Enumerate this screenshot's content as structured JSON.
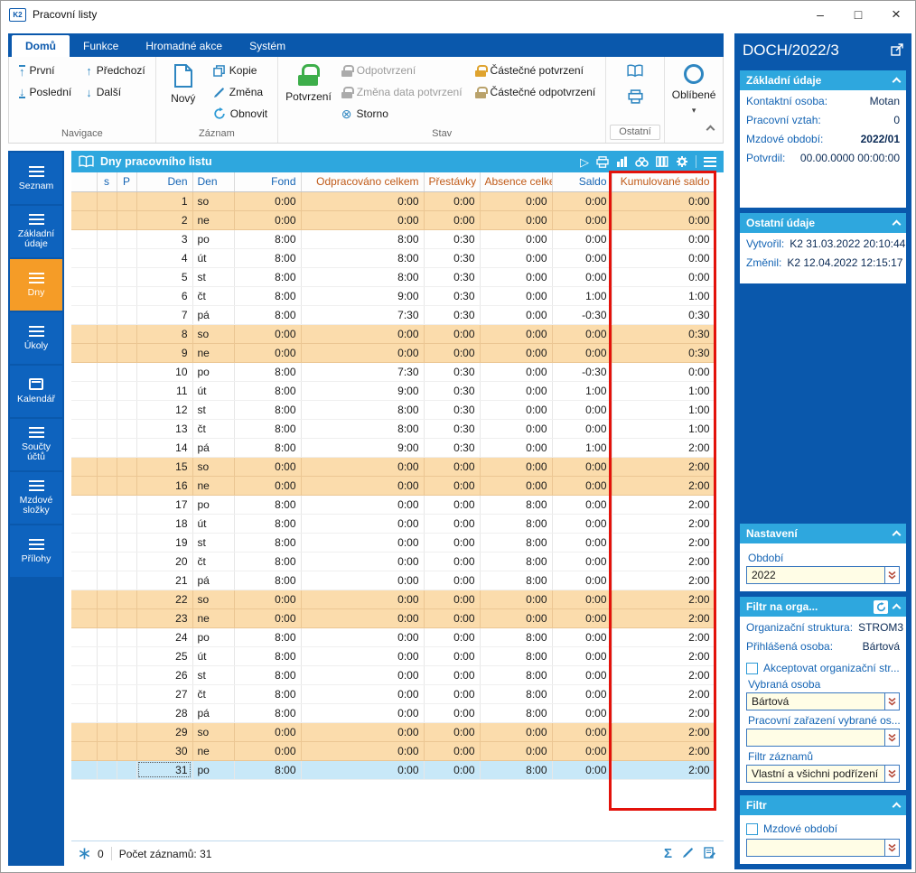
{
  "window": {
    "title": "Pracovní listy",
    "logo": "K2"
  },
  "tabs": [
    {
      "key": "domu",
      "label": "Domů",
      "active": true
    },
    {
      "key": "funkce",
      "label": "Funkce"
    },
    {
      "key": "hromadne-akce",
      "label": "Hromadné akce"
    },
    {
      "key": "system",
      "label": "Systém"
    }
  ],
  "ribbon": {
    "navigace": {
      "label": "Navigace",
      "prvni": "První",
      "posledni": "Poslední",
      "predchozi": "Předchozí",
      "dalsi": "Další"
    },
    "zaznam": {
      "label": "Záznam",
      "novy": "Nový",
      "kopie": "Kopie",
      "zmena": "Změna",
      "obnovit": "Obnovit"
    },
    "stav": {
      "label": "Stav",
      "potvrzeni": "Potvrzení",
      "odpotvrzeni": "Odpotvrzení",
      "zmena_data": "Změna data potvrzení",
      "storno": "Storno",
      "castecne_potvrzeni": "Částečné potvrzení",
      "castecne_odpotvrzeni": "Částečné odpotvrzení"
    },
    "ostatni": {
      "label": "Ostatní"
    },
    "oblibene": {
      "label": "Oblíbené"
    }
  },
  "sidebar": {
    "items": [
      {
        "key": "seznam",
        "label": "Seznam",
        "icon": "list"
      },
      {
        "key": "zakladni-udaje",
        "label": "Základní údaje",
        "icon": "list"
      },
      {
        "key": "dny",
        "label": "Dny",
        "icon": "list",
        "active": true
      },
      {
        "key": "ukoly",
        "label": "Úkoly",
        "icon": "list"
      },
      {
        "key": "kalendar",
        "label": "Kalendář",
        "icon": "calendar"
      },
      {
        "key": "soucty-uctu",
        "label": "Součty účtů",
        "icon": "list"
      },
      {
        "key": "mzdove-slozky",
        "label": "Mzdové složky",
        "icon": "list"
      },
      {
        "key": "prilohy",
        "label": "Přílohy",
        "icon": "list"
      }
    ]
  },
  "grid": {
    "title": "Dny pracovního listu",
    "columns": [
      {
        "key": "expander",
        "label": "",
        "color": "blue"
      },
      {
        "key": "s",
        "label": "s",
        "color": "blue"
      },
      {
        "key": "p",
        "label": "P",
        "color": "blue"
      },
      {
        "key": "den",
        "label": "Den",
        "color": "blue"
      },
      {
        "key": "nazev",
        "label": "Den",
        "color": "blue"
      },
      {
        "key": "fond",
        "label": "Fond",
        "color": "blue"
      },
      {
        "key": "odpracovano",
        "label": "Odpracováno celkem",
        "color": "orange"
      },
      {
        "key": "prestavky",
        "label": "Přestávky",
        "color": "orange"
      },
      {
        "key": "absence",
        "label": "Absence celkem",
        "color": "orange"
      },
      {
        "key": "saldo",
        "label": "Saldo",
        "color": "blue"
      },
      {
        "key": "kumulovane",
        "label": "Kumulované saldo",
        "color": "orange"
      }
    ],
    "rows": [
      {
        "den": 1,
        "nazev": "so",
        "fond": "0:00",
        "odpracovano": "0:00",
        "prestavky": "0:00",
        "absence": "0:00",
        "saldo": "0:00",
        "kumulovane": "0:00",
        "weekend": true
      },
      {
        "den": 2,
        "nazev": "ne",
        "fond": "0:00",
        "odpracovano": "0:00",
        "prestavky": "0:00",
        "absence": "0:00",
        "saldo": "0:00",
        "kumulovane": "0:00",
        "weekend": true
      },
      {
        "den": 3,
        "nazev": "po",
        "fond": "8:00",
        "odpracovano": "8:00",
        "prestavky": "0:30",
        "absence": "0:00",
        "saldo": "0:00",
        "kumulovane": "0:00"
      },
      {
        "den": 4,
        "nazev": "út",
        "fond": "8:00",
        "odpracovano": "8:00",
        "prestavky": "0:30",
        "absence": "0:00",
        "saldo": "0:00",
        "kumulovane": "0:00"
      },
      {
        "den": 5,
        "nazev": "st",
        "fond": "8:00",
        "odpracovano": "8:00",
        "prestavky": "0:30",
        "absence": "0:00",
        "saldo": "0:00",
        "kumulovane": "0:00"
      },
      {
        "den": 6,
        "nazev": "čt",
        "fond": "8:00",
        "odpracovano": "9:00",
        "prestavky": "0:30",
        "absence": "0:00",
        "saldo": "1:00",
        "kumulovane": "1:00"
      },
      {
        "den": 7,
        "nazev": "pá",
        "fond": "8:00",
        "odpracovano": "7:30",
        "prestavky": "0:30",
        "absence": "0:00",
        "saldo": "-0:30",
        "kumulovane": "0:30"
      },
      {
        "den": 8,
        "nazev": "so",
        "fond": "0:00",
        "odpracovano": "0:00",
        "prestavky": "0:00",
        "absence": "0:00",
        "saldo": "0:00",
        "kumulovane": "0:30",
        "weekend": true
      },
      {
        "den": 9,
        "nazev": "ne",
        "fond": "0:00",
        "odpracovano": "0:00",
        "prestavky": "0:00",
        "absence": "0:00",
        "saldo": "0:00",
        "kumulovane": "0:30",
        "weekend": true
      },
      {
        "den": 10,
        "nazev": "po",
        "fond": "8:00",
        "odpracovano": "7:30",
        "prestavky": "0:30",
        "absence": "0:00",
        "saldo": "-0:30",
        "kumulovane": "0:00"
      },
      {
        "den": 11,
        "nazev": "út",
        "fond": "8:00",
        "odpracovano": "9:00",
        "prestavky": "0:30",
        "absence": "0:00",
        "saldo": "1:00",
        "kumulovane": "1:00"
      },
      {
        "den": 12,
        "nazev": "st",
        "fond": "8:00",
        "odpracovano": "8:00",
        "prestavky": "0:30",
        "absence": "0:00",
        "saldo": "0:00",
        "kumulovane": "1:00"
      },
      {
        "den": 13,
        "nazev": "čt",
        "fond": "8:00",
        "odpracovano": "8:00",
        "prestavky": "0:30",
        "absence": "0:00",
        "saldo": "0:00",
        "kumulovane": "1:00"
      },
      {
        "den": 14,
        "nazev": "pá",
        "fond": "8:00",
        "odpracovano": "9:00",
        "prestavky": "0:30",
        "absence": "0:00",
        "saldo": "1:00",
        "kumulovane": "2:00"
      },
      {
        "den": 15,
        "nazev": "so",
        "fond": "0:00",
        "odpracovano": "0:00",
        "prestavky": "0:00",
        "absence": "0:00",
        "saldo": "0:00",
        "kumulovane": "2:00",
        "weekend": true
      },
      {
        "den": 16,
        "nazev": "ne",
        "fond": "0:00",
        "odpracovano": "0:00",
        "prestavky": "0:00",
        "absence": "0:00",
        "saldo": "0:00",
        "kumulovane": "2:00",
        "weekend": true
      },
      {
        "den": 17,
        "nazev": "po",
        "fond": "8:00",
        "odpracovano": "0:00",
        "prestavky": "0:00",
        "absence": "8:00",
        "saldo": "0:00",
        "kumulovane": "2:00"
      },
      {
        "den": 18,
        "nazev": "út",
        "fond": "8:00",
        "odpracovano": "0:00",
        "prestavky": "0:00",
        "absence": "8:00",
        "saldo": "0:00",
        "kumulovane": "2:00"
      },
      {
        "den": 19,
        "nazev": "st",
        "fond": "8:00",
        "odpracovano": "0:00",
        "prestavky": "0:00",
        "absence": "8:00",
        "saldo": "0:00",
        "kumulovane": "2:00"
      },
      {
        "den": 20,
        "nazev": "čt",
        "fond": "8:00",
        "odpracovano": "0:00",
        "prestavky": "0:00",
        "absence": "8:00",
        "saldo": "0:00",
        "kumulovane": "2:00"
      },
      {
        "den": 21,
        "nazev": "pá",
        "fond": "8:00",
        "odpracovano": "0:00",
        "prestavky": "0:00",
        "absence": "8:00",
        "saldo": "0:00",
        "kumulovane": "2:00"
      },
      {
        "den": 22,
        "nazev": "so",
        "fond": "0:00",
        "odpracovano": "0:00",
        "prestavky": "0:00",
        "absence": "0:00",
        "saldo": "0:00",
        "kumulovane": "2:00",
        "weekend": true
      },
      {
        "den": 23,
        "nazev": "ne",
        "fond": "0:00",
        "odpracovano": "0:00",
        "prestavky": "0:00",
        "absence": "0:00",
        "saldo": "0:00",
        "kumulovane": "2:00",
        "weekend": true
      },
      {
        "den": 24,
        "nazev": "po",
        "fond": "8:00",
        "odpracovano": "0:00",
        "prestavky": "0:00",
        "absence": "8:00",
        "saldo": "0:00",
        "kumulovane": "2:00"
      },
      {
        "den": 25,
        "nazev": "út",
        "fond": "8:00",
        "odpracovano": "0:00",
        "prestavky": "0:00",
        "absence": "8:00",
        "saldo": "0:00",
        "kumulovane": "2:00"
      },
      {
        "den": 26,
        "nazev": "st",
        "fond": "8:00",
        "odpracovano": "0:00",
        "prestavky": "0:00",
        "absence": "8:00",
        "saldo": "0:00",
        "kumulovane": "2:00"
      },
      {
        "den": 27,
        "nazev": "čt",
        "fond": "8:00",
        "odpracovano": "0:00",
        "prestavky": "0:00",
        "absence": "8:00",
        "saldo": "0:00",
        "kumulovane": "2:00"
      },
      {
        "den": 28,
        "nazev": "pá",
        "fond": "8:00",
        "odpracovano": "0:00",
        "prestavky": "0:00",
        "absence": "8:00",
        "saldo": "0:00",
        "kumulovane": "2:00"
      },
      {
        "den": 29,
        "nazev": "so",
        "fond": "0:00",
        "odpracovano": "0:00",
        "prestavky": "0:00",
        "absence": "0:00",
        "saldo": "0:00",
        "kumulovane": "2:00",
        "weekend": true
      },
      {
        "den": 30,
        "nazev": "ne",
        "fond": "0:00",
        "odpracovano": "0:00",
        "prestavky": "0:00",
        "absence": "0:00",
        "saldo": "0:00",
        "kumulovane": "2:00",
        "weekend": true
      },
      {
        "den": 31,
        "nazev": "po",
        "fond": "8:00",
        "odpracovano": "0:00",
        "prestavky": "0:00",
        "absence": "8:00",
        "saldo": "0:00",
        "kumulovane": "2:00",
        "selected": true
      }
    ],
    "status": {
      "counter": "0",
      "count_label": "Počet záznamů: 31"
    }
  },
  "right_panel": {
    "title": "DOCH/2022/3",
    "zakladni_udaje": {
      "header": "Základní údaje",
      "fields": [
        {
          "label": "Kontaktní osoba:",
          "value": "Motan"
        },
        {
          "label": "Pracovní vztah:",
          "value": "0"
        },
        {
          "label": "Mzdové období:",
          "value": "2022/01",
          "bold": true
        },
        {
          "label": "Potvrdil:",
          "value": "00.00.0000 00:00:00"
        }
      ]
    },
    "ostatni_udaje": {
      "header": "Ostatní údaje",
      "fields": [
        {
          "label": "Vytvořil:",
          "value": "K2 31.03.2022 20:10:44"
        },
        {
          "label": "Změnil:",
          "value": "K2 12.04.2022 12:15:17"
        }
      ]
    },
    "nastaveni": {
      "header": "Nastavení",
      "obdobi_label": "Období",
      "obdobi_value": "2022"
    },
    "filtr_orga": {
      "header": "Filtr na orga...",
      "fields": [
        {
          "label": "Organizační struktura:",
          "value": "STROM3"
        },
        {
          "label": "Přihlášená osoba:",
          "value": "Bártová"
        }
      ],
      "checkbox_label": "Akceptovat organizační str...",
      "vybrana_osoba_label": "Vybraná osoba",
      "vybrana_osoba_value": "Bártová",
      "pracovni_zarazeni_label": "Pracovní zařazení vybrané os...",
      "pracovni_zarazeni_value": "",
      "filtr_zaznamu_label": "Filtr záznamů",
      "filtr_zaznamu_value": "Vlastní a všichni podřízení"
    },
    "filtr": {
      "header": "Filtr",
      "checkbox_label": "Mzdové období",
      "combo_value": ""
    }
  },
  "icons": [
    "k2-logo",
    "open-book-icon",
    "run-icon",
    "print-icon",
    "chart-icon",
    "binoculars-icon",
    "columns-icon",
    "gear-icon",
    "menu-icon",
    "asterisk-icon",
    "sum-icon",
    "edit-pen-icon",
    "form-edit-icon",
    "open-window-icon",
    "collapse-icon",
    "refresh-icon",
    "combo-dropdown-icon",
    "new-document-icon",
    "copy-icon",
    "green-lock-icon",
    "gray-lock-icon",
    "gold-lock-icon",
    "storno-icon",
    "favorites-o-icon"
  ]
}
